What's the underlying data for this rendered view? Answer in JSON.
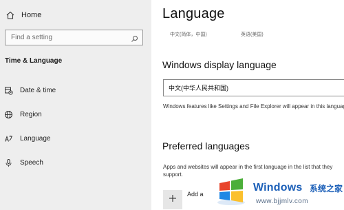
{
  "sidebar": {
    "home_label": "Home",
    "search_placeholder": "Find a setting",
    "section_title": "Time & Language",
    "items": [
      {
        "label": "Date & time",
        "icon": "calendar-clock-icon"
      },
      {
        "label": "Region",
        "icon": "globe-icon"
      },
      {
        "label": "Language",
        "icon": "language-icon"
      },
      {
        "label": "Speech",
        "icon": "microphone-icon"
      }
    ]
  },
  "main": {
    "title": "Language",
    "current_languages": [
      "中文(简体，中国)",
      "英语(美国)"
    ],
    "display_language": {
      "heading": "Windows display language",
      "selected": "中文(中华人民共和国)",
      "description": "Windows features like Settings and File Explorer will appear in this language."
    },
    "preferred_languages": {
      "heading": "Preferred languages",
      "description": "Apps and websites will appear in the first language in the list that they support.",
      "add_label": "Add a"
    }
  },
  "watermark": {
    "title": "Windows",
    "subtitle_cn": "系统之家",
    "url": "www.bjjmlv.com"
  },
  "colors": {
    "sidebar_bg": "#eeeeee",
    "watermark_blue": "#1b5fb8"
  }
}
